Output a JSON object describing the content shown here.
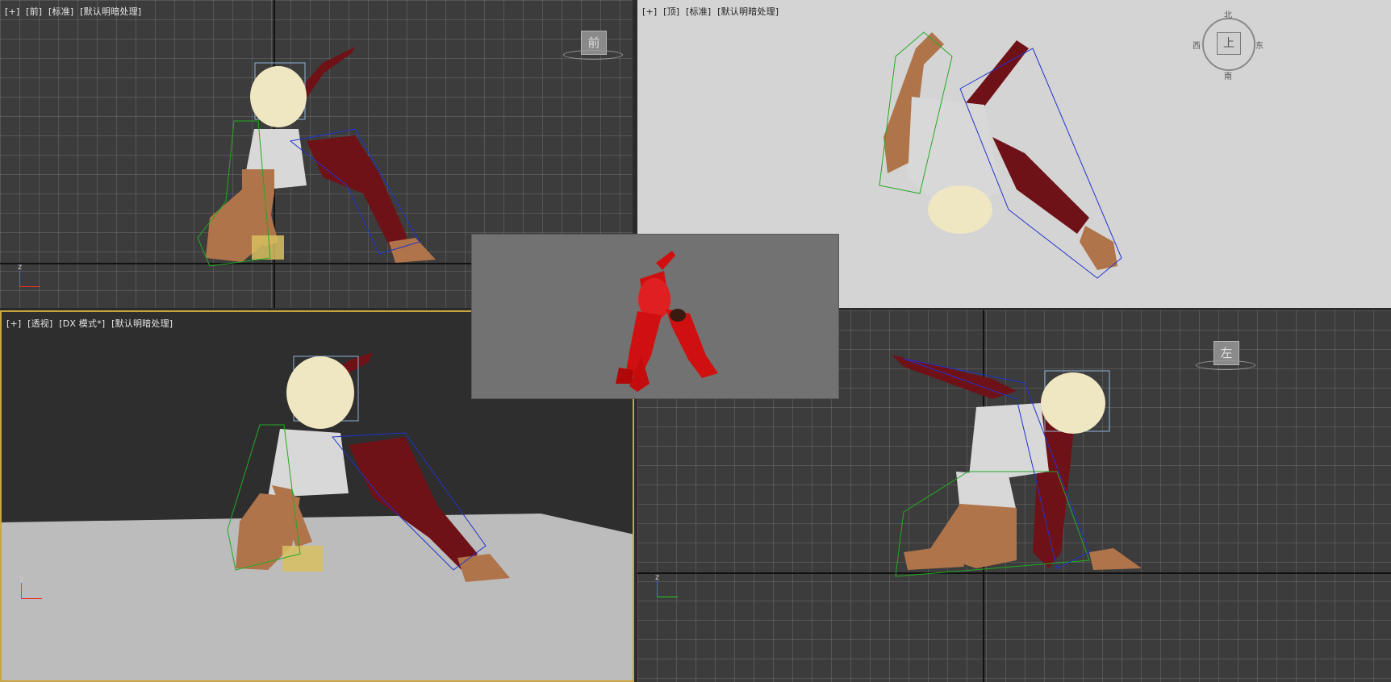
{
  "viewports": {
    "front": {
      "labels": [
        "[+]",
        "[前]",
        "[标准]",
        "[默认明暗处理]"
      ],
      "viewcube_label": "前",
      "axis_labels": {
        "up": "z",
        "side": "x"
      }
    },
    "top": {
      "labels": [
        "[+]",
        "[顶]",
        "[标准]",
        "[默认明暗处理]"
      ],
      "viewcube_label": "上",
      "compass": {
        "north": "北",
        "south": "南",
        "east": "东",
        "west": "西"
      }
    },
    "perspective": {
      "labels": [
        "[+]",
        "[透视]",
        "[DX 模式*]",
        "[默认明暗处理]"
      ],
      "axis_labels": {
        "up": "z",
        "side": "x"
      }
    },
    "left": {
      "viewcube_label": "左",
      "axis_labels": {
        "up": "z",
        "side": "y"
      }
    }
  },
  "colors": {
    "viewport_dark": "#3c3c3c",
    "viewport_light": "#d4d4d4",
    "active_border": "#c9a540",
    "preview_bg": "#727272",
    "figure_red": "#d01010",
    "skin": "#b0744a",
    "hair": "#efe6c2",
    "stocking": "#6e1218",
    "bone_blue": "#2233cc",
    "bone_green": "#22aa22"
  }
}
